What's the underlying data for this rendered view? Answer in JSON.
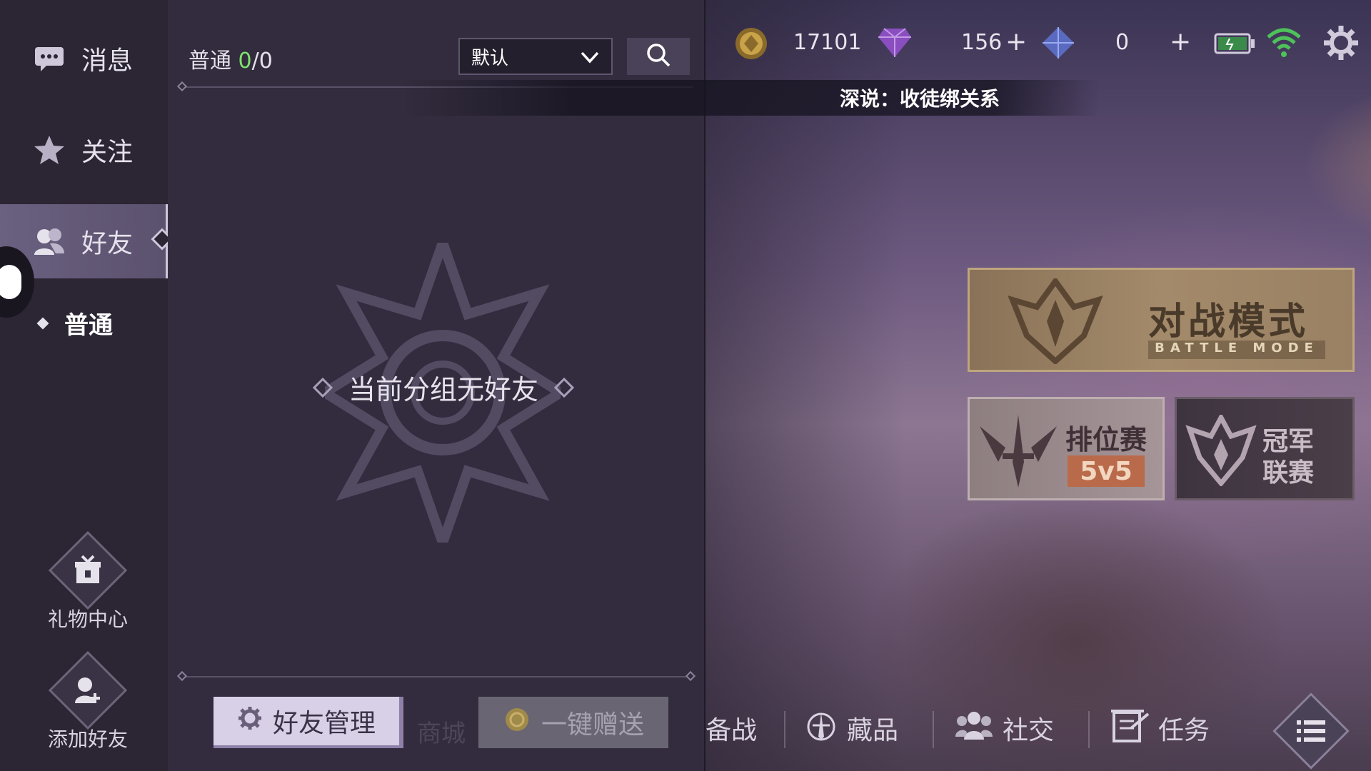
{
  "sidebar": {
    "items": [
      {
        "label": "消息",
        "icon": "chat-icon"
      },
      {
        "label": "关注",
        "icon": "star-icon"
      },
      {
        "label": "好友",
        "icon": "friends-icon",
        "active": true
      }
    ],
    "sub_item": "普通",
    "gift_center": "礼物中心",
    "add_friend": "添加好友"
  },
  "panel": {
    "group_name": "普通",
    "online_count": "0",
    "total_count": "/0",
    "select_value": "默认",
    "empty_message": "当前分组无好友",
    "manage_button": "好友管理",
    "gift_button": "一键赠送",
    "ghost_shop": "商城"
  },
  "header": {
    "gold": "17101",
    "gems": "156",
    "crystals": "0",
    "notice": "深说：收徒绑关系"
  },
  "modes": {
    "battle_title": "对战模式",
    "battle_sub": "BATTLE MODE",
    "ranked_title": "排位赛",
    "ranked_tag": "5v5",
    "champion_line1": "冠军",
    "champion_line2": "联赛"
  },
  "bottom_nav": {
    "prepare": "备战",
    "collection": "藏品",
    "social": "社交",
    "tasks": "任务"
  },
  "colors": {
    "online_green": "#7ee26b",
    "panel_bg": "#332c3e",
    "sidebar_bg": "#2b2534",
    "battle_gold": "#a38a6a"
  }
}
